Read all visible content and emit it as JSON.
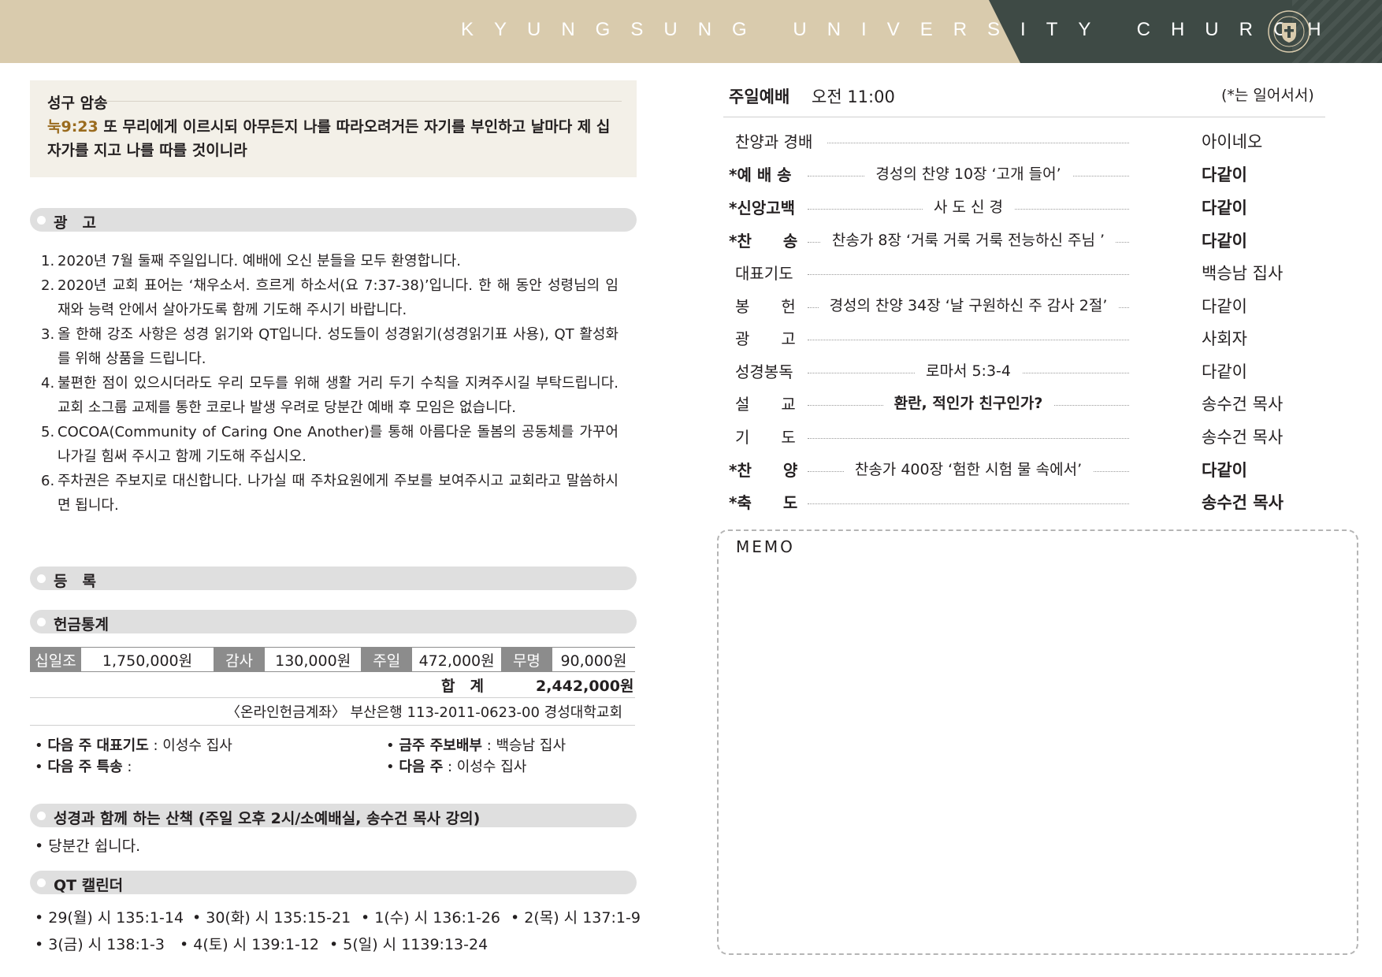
{
  "header": {
    "title": "KYUNGSUNG UNIVERSITY CHURCH",
    "emblem_icon": "university-emblem-icon",
    "background": "#d9cbad",
    "accent": "#3e4a45"
  },
  "verse": {
    "title": "성구 암송",
    "reference": "눅9:23",
    "text": "또 무리에게 이르시되 아무든지 나를 따라오려거든 자기를 부인하고 날마다 제 십자가를 지고 나를 따를 것이니라"
  },
  "notices": {
    "title": "광　고",
    "items": [
      {
        "num": "1.",
        "text": "2020년 7월 둘째 주일입니다. 예배에 오신 분들을 모두 환영합니다."
      },
      {
        "num": "2.",
        "text": "2020년 교회 표어는 ‘채우소서. 흐르게 하소서(요 7:37-38)’입니다. 한 해 동안 성령님의 임재와 능력 안에서 살아가도록 함께 기도해 주시기 바랍니다."
      },
      {
        "num": "3.",
        "text": "올 한해 강조 사항은 성경 읽기와 QT입니다. 성도들이 성경읽기(성경읽기표 사용), QT 활성화를 위해 상품을 드립니다."
      },
      {
        "num": "4.",
        "text": "불편한 점이 있으시더라도 우리 모두를 위해 생활 거리 두기 수칙을 지켜주시길 부탁드립니다. 교회 소그룹 교제를 통한 코로나 발생 우려로 당분간 예배 후 모임은 없습니다."
      },
      {
        "num": "5.",
        "text": "COCOA(Community of Caring One Another)를 통해 아름다운 돌봄의 공동체를 가꾸어나가길 힘써 주시고 함께 기도해 주십시오."
      },
      {
        "num": "6.",
        "text": "주차권은 주보지로 대신합니다. 나가실 때 주차요원에게 주보를 보여주시고 교회라고 말씀하시면 됩니다."
      }
    ]
  },
  "registration": {
    "title": "등　록"
  },
  "offering": {
    "title": "헌금통계",
    "items": [
      {
        "label": "십일조",
        "value": "1,750,000원"
      },
      {
        "label": "감사",
        "value": "130,000원"
      },
      {
        "label": "주일",
        "value": "472,000원"
      },
      {
        "label": "무명",
        "value": "90,000원"
      }
    ],
    "total_label": "합　계",
    "total_value": "2,442,000원",
    "account": "〈온라인헌금계좌〉 부산은행 113-2011-0623-00 경성대학교회"
  },
  "duties": {
    "next_prayer_label": "다음 주 대표기도",
    "next_prayer_value": " : 이성수 집사",
    "next_special_label": "다음 주 특송",
    "next_special_value": " :",
    "bulletin_label": "금주 주보배부",
    "bulletin_value": " : 백승남 집사",
    "next_week_label": "다음 주",
    "next_week_value": " : 이성수 집사"
  },
  "walk": {
    "title": "성경과 함께 하는 산책 (주일 오후 2시/소예배실, 송수건 목사 강의)",
    "note": "당분간 쉽니다."
  },
  "qt": {
    "title": "QT 캘린더",
    "items": [
      "29(월) 시 135:1-14",
      "30(화) 시 135:15-21",
      "1(수) 시 136:1-26",
      "2(목) 시 137:1-9",
      "3(금) 시 138:1-3",
      "4(토) 시 139:1-12",
      "5(일) 시 1139:13-24"
    ]
  },
  "service": {
    "title": "주일예배",
    "time": "오전 11:00",
    "note": "(*는 일어서서)",
    "rows": [
      {
        "name": "찬양과 경배",
        "content": "",
        "who": "아이네오"
      },
      {
        "name": "*예 배 송",
        "content": "경성의 찬양 10장 ‘고개 들어’",
        "who": "다같이"
      },
      {
        "name": "*신앙고백",
        "content": "사 도 신 경",
        "who": "다같이"
      },
      {
        "name": "*찬　　송",
        "content": "찬송가 8장 ‘거룩 거룩 거룩 전능하신 주님 ’",
        "who": "다같이"
      },
      {
        "name": "대표기도",
        "content": "",
        "who": "백승남 집사"
      },
      {
        "name": "봉　　헌",
        "content": "경성의 찬양 34장 ‘날 구원하신 주 감사 2절’",
        "who": "다같이"
      },
      {
        "name": "광　　고",
        "content": "",
        "who": "사회자"
      },
      {
        "name": "성경봉독",
        "content": "로마서 5:3-4",
        "who": "다같이"
      },
      {
        "name": "설　　교",
        "content": "환란, 적인가 친구인가?",
        "who": "송수건 목사"
      },
      {
        "name": "기　　도",
        "content": "",
        "who": "송수건 목사"
      },
      {
        "name": "*찬　　양",
        "content": "찬송가 400장 ‘험한 시험 물 속에서’",
        "who": "다같이"
      },
      {
        "name": "*축　　도",
        "content": "",
        "who": "송수건 목사"
      }
    ]
  },
  "memo": {
    "title": "MEMO"
  }
}
